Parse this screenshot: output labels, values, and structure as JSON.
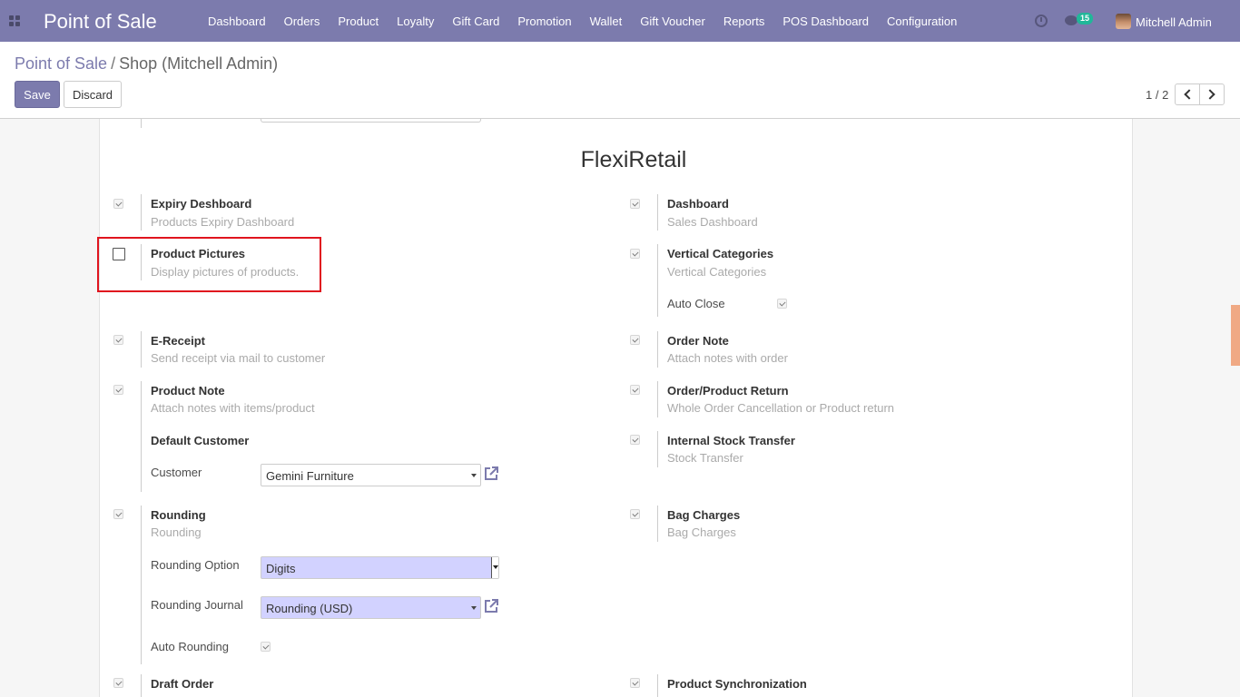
{
  "app": {
    "brand": "Point of Sale"
  },
  "menu": [
    "Dashboard",
    "Orders",
    "Product",
    "Loyalty",
    "Gift Card",
    "Promotion",
    "Wallet",
    "Gift Voucher",
    "Reports",
    "POS Dashboard",
    "Configuration"
  ],
  "systray": {
    "message_count": "15",
    "user_name": "Mitchell Admin"
  },
  "breadcrumb": {
    "parent": "Point of Sale",
    "separator": "/",
    "current": "Shop (Mitchell Admin)"
  },
  "buttons": {
    "save": "Save",
    "discard": "Discard"
  },
  "pager": {
    "value": "1 / 2"
  },
  "section": {
    "title": "FlexiRetail"
  },
  "fields": {
    "expiry_dashboard": {
      "title": "Expiry Deshboard",
      "desc": "Products Expiry Dashboard",
      "checked": true
    },
    "dashboard": {
      "title": "Dashboard",
      "desc": "Sales Dashboard",
      "checked": true
    },
    "product_pictures": {
      "title": "Product Pictures",
      "desc": "Display pictures of products.",
      "checked": false
    },
    "vertical_categories": {
      "title": "Vertical Categories",
      "desc": "Vertical Categories",
      "checked": true
    },
    "auto_close": {
      "label": "Auto Close",
      "checked": true
    },
    "e_receipt": {
      "title": "E-Receipt",
      "desc": "Send receipt via mail to customer",
      "checked": true
    },
    "order_note": {
      "title": "Order Note",
      "desc": "Attach notes with order",
      "checked": true
    },
    "product_note": {
      "title": "Product Note",
      "desc": "Attach notes with items/product",
      "checked": true
    },
    "order_product_return": {
      "title": "Order/Product Return",
      "desc": "Whole Order Cancellation or Product return",
      "checked": true
    },
    "default_customer": {
      "title": "Default Customer"
    },
    "customer": {
      "label": "Customer",
      "value": "Gemini Furniture"
    },
    "internal_stock_transfer": {
      "title": "Internal Stock Transfer",
      "desc": "Stock Transfer",
      "checked": true
    },
    "rounding": {
      "title": "Rounding",
      "desc": "Rounding",
      "checked": true
    },
    "bag_charges": {
      "title": "Bag Charges",
      "desc": "Bag Charges",
      "checked": true
    },
    "rounding_option": {
      "label": "Rounding Option",
      "value": "Digits"
    },
    "rounding_journal": {
      "label": "Rounding Journal",
      "value": "Rounding (USD)"
    },
    "auto_rounding": {
      "label": "Auto Rounding",
      "checked": true
    },
    "draft_order": {
      "title": "Draft Order",
      "checked": true
    },
    "product_sync": {
      "title": "Product Synchronization",
      "checked": true
    }
  },
  "colors": {
    "navbar": "#7c7bad",
    "primary": "#7c7bad",
    "highlight": "#e0141e",
    "required_field": "#d2d2ff",
    "badge": "#21b799"
  },
  "icons": [
    "apps-icon",
    "clock-icon",
    "chat-icon",
    "chevron-left-icon",
    "chevron-right-icon",
    "external-link-icon"
  ]
}
